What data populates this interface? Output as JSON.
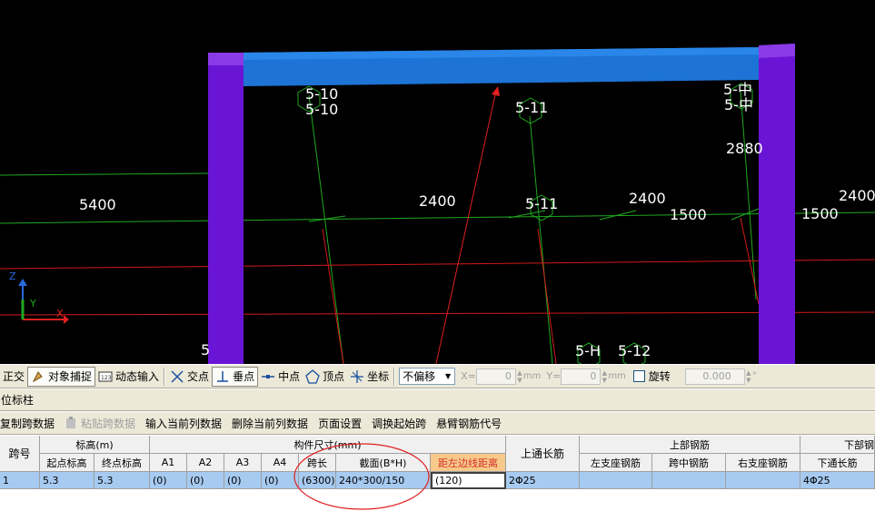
{
  "viewport": {
    "labels": {
      "span_5400": "5400",
      "span_2400_a": "2400",
      "span_2400_b": "2400",
      "span_2400_c": "2400",
      "span_1500_a": "1500",
      "span_1500_b": "1500",
      "dim_2880": "2880",
      "axis_5_10_a": "5-10",
      "axis_5_10_b": "5-10",
      "axis_5_11_a": "5-11",
      "axis_5_11_b": "5-11",
      "axis_5_zhong_a": "5-中",
      "axis_5_zhong_b": "5-中",
      "axis_5_h": "5-H",
      "axis_5_12": "5-12",
      "axis_5_partial": "5",
      "axis_z": "Z",
      "axis_y": "Y",
      "axis_x": "X"
    },
    "colors": {
      "beam": "#1d74d6",
      "column": "#6a15d6",
      "grid_green": "#1faa1f",
      "grid_red": "#d21a1a",
      "annotation": "#e02020"
    }
  },
  "snapbar": {
    "ortho": "正交",
    "snap": "对象捕捉",
    "dynamic_input": "动态输入",
    "intersection": "交点",
    "perpendicular": "垂点",
    "midpoint": "中点",
    "vertex": "顶点",
    "coordinate": "坐标",
    "offset_mode": "不偏移",
    "x_label": "X=",
    "x_value": "0",
    "y_label": "Y=",
    "y_value": "0",
    "unit_mm": "mm",
    "rotate_label": "旋转",
    "rotate_value": "0.000",
    "degree": "°"
  },
  "panel": {
    "title": "位标柱"
  },
  "actions": {
    "copy_span": "复制跨数据",
    "paste_span": "粘贴跨数据",
    "input_column": "输入当前列数据",
    "delete_column": "删除当前列数据",
    "page_setup": "页面设置",
    "swap_start": "调换起始跨",
    "cantilever_code": "悬臂钢筋代号"
  },
  "table": {
    "headers": {
      "span_no": "跨号",
      "elevation": "标高(m)",
      "start_elev": "起点标高",
      "end_elev": "终点标高",
      "member_size": "构件尺寸(mm)",
      "a1": "A1",
      "a2": "A2",
      "a3": "A3",
      "a4": "A4",
      "span_len": "跨长",
      "section": "截面(B*H)",
      "left_edge_dist": "距左边线距离",
      "top_through": "上通长筋",
      "top_rebar": "上部钢筋",
      "left_support": "左支座钢筋",
      "mid_span": "跨中钢筋",
      "right_support": "右支座钢筋",
      "bottom_rebar": "下部钢",
      "bottom_through": "下通长筋"
    },
    "rows": [
      {
        "span_no": "1",
        "start_elev": "5.3",
        "end_elev": "5.3",
        "a1": "(0)",
        "a2": "(0)",
        "a3": "(0)",
        "a4": "(0)",
        "span_len": "(6300)",
        "section": "240*300/150",
        "left_edge_dist": "(120)",
        "top_through": "2Φ25",
        "left_support": "",
        "mid_span": "",
        "right_support": "",
        "bottom_through": "4Φ25"
      }
    ]
  }
}
